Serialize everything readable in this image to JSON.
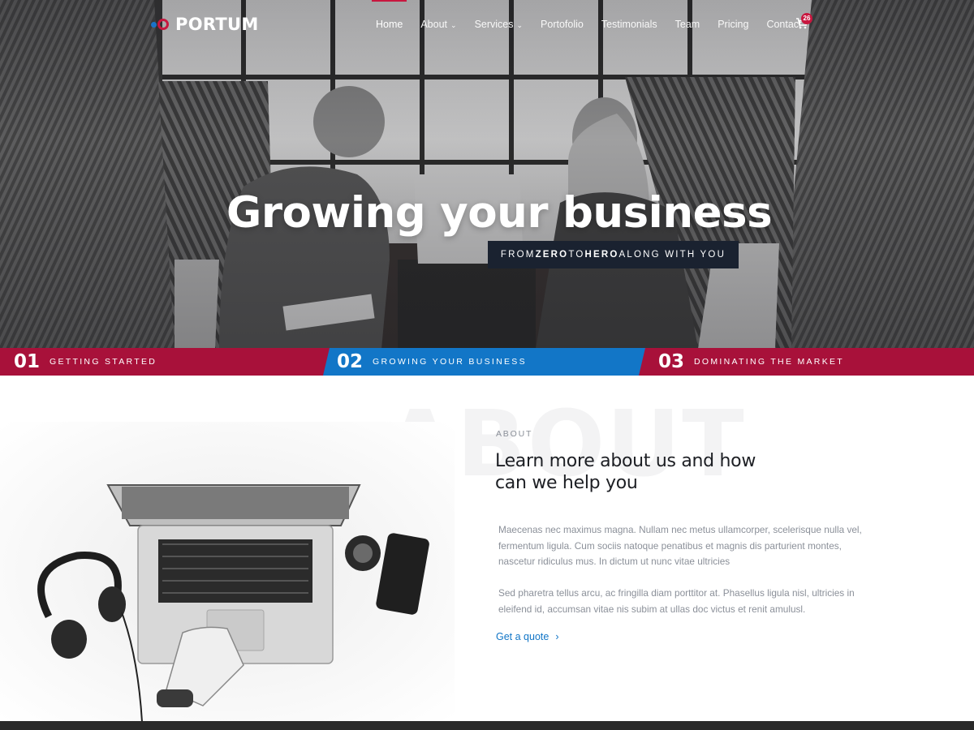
{
  "brand": {
    "name": "PORTUM"
  },
  "nav": {
    "items": [
      {
        "label": "Home",
        "active": true,
        "dropdown": false
      },
      {
        "label": "About",
        "active": false,
        "dropdown": true
      },
      {
        "label": "Services",
        "active": false,
        "dropdown": true
      },
      {
        "label": "Portofolio",
        "active": false,
        "dropdown": false
      },
      {
        "label": "Testimonials",
        "active": false,
        "dropdown": false
      },
      {
        "label": "Team",
        "active": false,
        "dropdown": false
      },
      {
        "label": "Pricing",
        "active": false,
        "dropdown": false
      },
      {
        "label": "Contact",
        "active": false,
        "dropdown": false
      }
    ],
    "cart_count": "26",
    "cart_icon": "shopping-cart-icon"
  },
  "hero": {
    "title": "Growing your business",
    "subtitle_parts": [
      "FROM ",
      "ZERO",
      " TO ",
      "HERO",
      " ALONG WITH YOU"
    ]
  },
  "steps": [
    {
      "number": "01",
      "label": "GETTING STARTED"
    },
    {
      "number": "02",
      "label": "GROWING YOUR BUSINESS"
    },
    {
      "number": "03",
      "label": "DOMINATING THE MARKET"
    }
  ],
  "about": {
    "watermark": "ABOUT",
    "eyebrow": "ABOUT",
    "heading": "Learn more about us and how can we help you",
    "paragraph1": "Maecenas nec maximus magna. Nullam nec metus ullamcorper, scelerisque nulla vel, fermentum ligula. Cum sociis natoque penatibus et magnis dis parturient montes, nascetur ridiculus mus. In dictum ut nunc vitae ultricies",
    "paragraph2": "Sed pharetra tellus arcu, ac fringilla diam porttitor at. Phasellus ligula nisl, ultricies in eleifend id, accumsan vitae nis subim at ullas doc victus et renit amulusl.",
    "cta_label": "Get a quote"
  },
  "colors": {
    "accent_red": "#a8113a",
    "accent_blue": "#1276c7",
    "dark_navy": "#1a2230"
  }
}
